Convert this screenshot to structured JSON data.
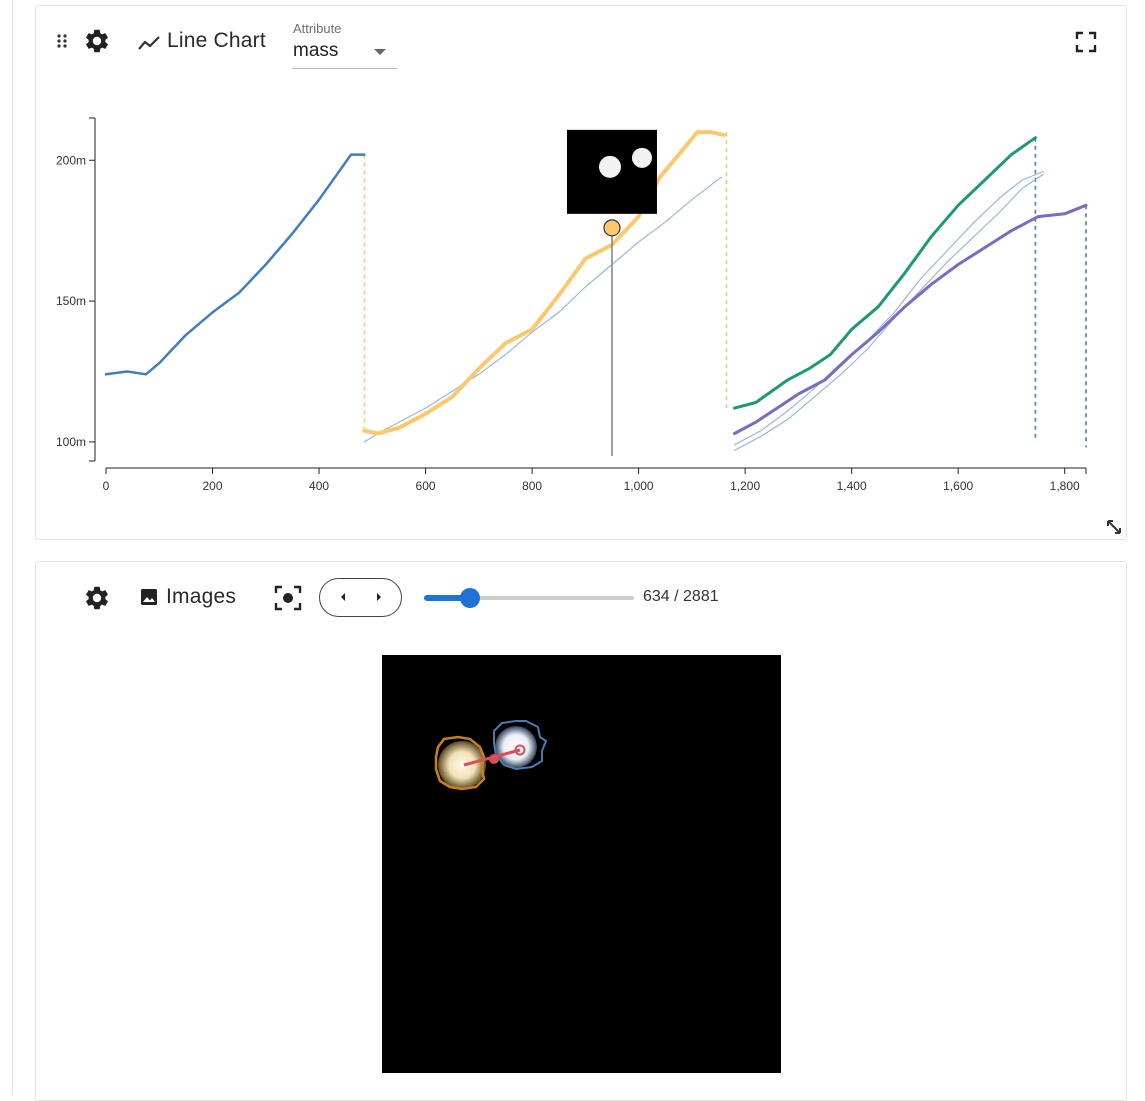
{
  "line_chart_panel": {
    "title": "Line Chart",
    "attribute_label": "Attribute",
    "attribute_value": "mass",
    "icons": [
      "drag-handle-icon",
      "gear-icon",
      "line-chart-icon",
      "fullscreen-icon",
      "resize-icon"
    ]
  },
  "images_panel": {
    "title": "Images",
    "frame_current": 634,
    "frame_total": 2881,
    "frame_readout": "634 / 2881",
    "icons": [
      "gear-icon",
      "image-icon",
      "focus-target-icon",
      "chevron-left-icon",
      "chevron-right-icon"
    ]
  },
  "chart_data": {
    "type": "line",
    "title": "",
    "xlabel": "",
    "ylabel": "",
    "xlim": [
      0,
      1840
    ],
    "ylim": [
      95,
      215
    ],
    "x_ticks": [
      0,
      200,
      400,
      600,
      800,
      1000,
      1200,
      1400,
      1600,
      1800
    ],
    "x_tick_labels": [
      "0",
      "200",
      "400",
      "600",
      "800",
      "1,000",
      "1,200",
      "1,400",
      "1,600",
      "1,800"
    ],
    "y_ticks": [
      100,
      150,
      200
    ],
    "y_tick_labels": [
      "100m",
      "150m",
      "200m"
    ],
    "grid": false,
    "legend": "none",
    "series": [
      {
        "color": "#3f7fbf",
        "width": 2.5,
        "points": [
          [
            0,
            124
          ],
          [
            40,
            125
          ],
          [
            75,
            124
          ],
          [
            100,
            128
          ],
          [
            150,
            138
          ],
          [
            200,
            146
          ],
          [
            250,
            153
          ],
          [
            300,
            163
          ],
          [
            350,
            174
          ],
          [
            400,
            186
          ],
          [
            430,
            194
          ],
          [
            460,
            202
          ],
          [
            485,
            202
          ]
        ]
      },
      {
        "color": "#fbc86e",
        "width": 4,
        "points": [
          [
            485,
            104
          ],
          [
            510,
            103
          ],
          [
            550,
            105
          ],
          [
            600,
            110
          ],
          [
            650,
            116
          ],
          [
            700,
            126
          ],
          [
            750,
            135
          ],
          [
            800,
            140
          ],
          [
            850,
            152
          ],
          [
            900,
            165
          ],
          [
            950,
            170
          ],
          [
            1000,
            180
          ],
          [
            1040,
            194
          ],
          [
            1080,
            203
          ],
          [
            1110,
            210
          ],
          [
            1135,
            210
          ],
          [
            1160,
            209
          ]
        ]
      },
      {
        "color": "#98b8d6",
        "width": 1.2,
        "points": [
          [
            485,
            100
          ],
          [
            520,
            104
          ],
          [
            560,
            108
          ],
          [
            600,
            112
          ],
          [
            650,
            118
          ],
          [
            700,
            124
          ],
          [
            750,
            131
          ],
          [
            800,
            139
          ],
          [
            850,
            146
          ],
          [
            900,
            155
          ],
          [
            950,
            163
          ],
          [
            1000,
            171
          ],
          [
            1050,
            178
          ],
          [
            1100,
            186
          ],
          [
            1155,
            194
          ]
        ]
      },
      {
        "color": "#1e9a6e",
        "width": 3,
        "points": [
          [
            1180,
            112
          ],
          [
            1220,
            114
          ],
          [
            1280,
            122
          ],
          [
            1320,
            126
          ],
          [
            1360,
            131
          ],
          [
            1400,
            140
          ],
          [
            1450,
            148
          ],
          [
            1500,
            160
          ],
          [
            1550,
            173
          ],
          [
            1600,
            184
          ],
          [
            1650,
            193
          ],
          [
            1700,
            202
          ],
          [
            1745,
            208
          ]
        ]
      },
      {
        "color": "#7c6bbf",
        "width": 3,
        "points": [
          [
            1180,
            103
          ],
          [
            1220,
            107
          ],
          [
            1260,
            112
          ],
          [
            1300,
            117
          ],
          [
            1350,
            122
          ],
          [
            1400,
            131
          ],
          [
            1450,
            139
          ],
          [
            1500,
            148
          ],
          [
            1550,
            156
          ],
          [
            1600,
            163
          ],
          [
            1650,
            169
          ],
          [
            1700,
            175
          ],
          [
            1750,
            180
          ],
          [
            1800,
            181
          ],
          [
            1840,
            184
          ]
        ]
      },
      {
        "color": "#98b8d6",
        "width": 1.2,
        "points": [
          [
            1180,
            97
          ],
          [
            1230,
            102
          ],
          [
            1280,
            108
          ],
          [
            1330,
            116
          ],
          [
            1380,
            124
          ],
          [
            1430,
            133
          ],
          [
            1480,
            144
          ],
          [
            1530,
            154
          ],
          [
            1580,
            164
          ],
          [
            1630,
            173
          ],
          [
            1680,
            182
          ],
          [
            1720,
            190
          ],
          [
            1760,
            195
          ]
        ]
      },
      {
        "color": "#98b8d6",
        "width": 1.2,
        "points": [
          [
            1180,
            99
          ],
          [
            1230,
            104
          ],
          [
            1280,
            111
          ],
          [
            1330,
            119
          ],
          [
            1380,
            128
          ],
          [
            1430,
            136
          ],
          [
            1480,
            146
          ],
          [
            1530,
            158
          ],
          [
            1580,
            168
          ],
          [
            1630,
            178
          ],
          [
            1680,
            187
          ],
          [
            1720,
            193
          ],
          [
            1760,
            196
          ]
        ]
      }
    ],
    "dashed_connectors": [
      {
        "color": "#fbc86e",
        "x": 485,
        "y_from": 202,
        "y_to": 104
      },
      {
        "color": "#fbc86e",
        "x": 1165,
        "y_from": 210,
        "y_to": 112
      },
      {
        "color": "#3f7fbf",
        "x": 1745,
        "y_from": 208,
        "y_to": 100
      },
      {
        "color": "#3f7fbf",
        "x": 1840,
        "y_from": 184,
        "y_to": 98
      }
    ],
    "cursor": {
      "x": 950,
      "y": 176,
      "marker_color": "#fbc86e"
    }
  }
}
